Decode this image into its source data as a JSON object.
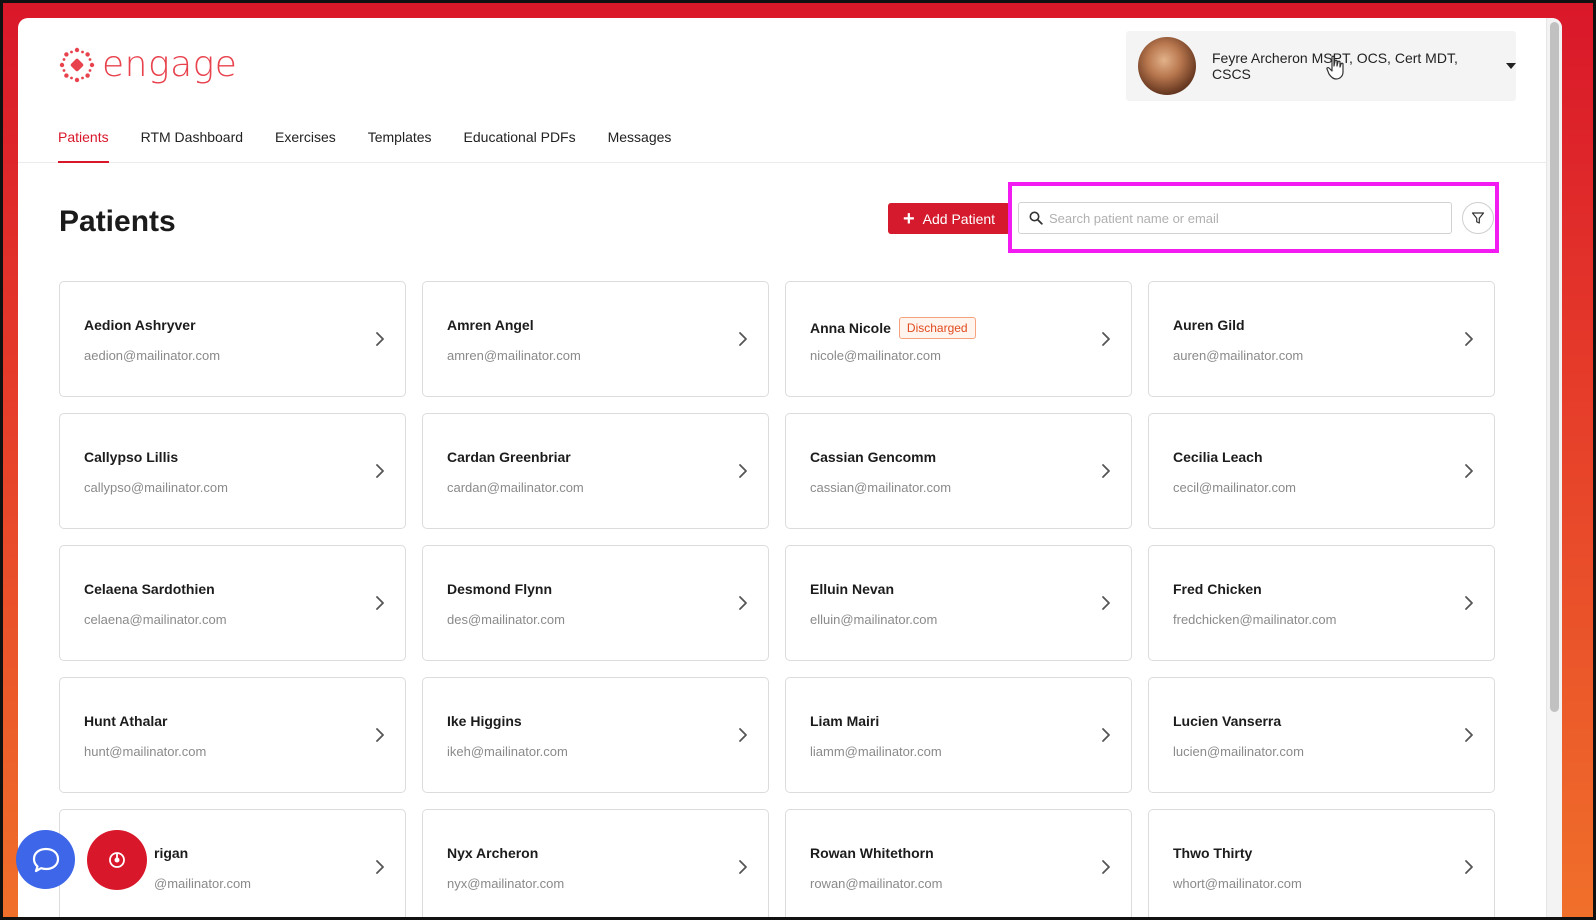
{
  "app": {
    "logo_text": "engage",
    "brand_color": "#d9172a",
    "accent_logo_color": "#e8424d"
  },
  "user": {
    "name": "Feyre Archeron MSPT, OCS, Cert MDT, CSCS",
    "avatar_icon": "user-avatar",
    "dropdown_icon": "caret-down-icon"
  },
  "nav": {
    "items": [
      {
        "label": "Patients",
        "active": true
      },
      {
        "label": "RTM Dashboard",
        "active": false
      },
      {
        "label": "Exercises",
        "active": false
      },
      {
        "label": "Templates",
        "active": false
      },
      {
        "label": "Educational PDFs",
        "active": false
      },
      {
        "label": "Messages",
        "active": false
      }
    ]
  },
  "page": {
    "title": "Patients",
    "add_button_label": "Add Patient",
    "search_placeholder": "Search patient name or email",
    "search_value": "",
    "highlight_color": "#f21cf2"
  },
  "patients": [
    {
      "name": "Aedion Ashryver",
      "email": "aedion@mailinator.com",
      "badge": ""
    },
    {
      "name": "Amren Angel",
      "email": "amren@mailinator.com",
      "badge": ""
    },
    {
      "name": "Anna Nicole",
      "email": "nicole@mailinator.com",
      "badge": "Discharged"
    },
    {
      "name": "Auren Gild",
      "email": "auren@mailinator.com",
      "badge": ""
    },
    {
      "name": "Callypso Lillis",
      "email": "callypso@mailinator.com",
      "badge": ""
    },
    {
      "name": "Cardan Greenbriar",
      "email": "cardan@mailinator.com",
      "badge": ""
    },
    {
      "name": "Cassian Gencomm",
      "email": "cassian@mailinator.com",
      "badge": ""
    },
    {
      "name": "Cecilia Leach",
      "email": "cecil@mailinator.com",
      "badge": ""
    },
    {
      "name": "Celaena Sardothien",
      "email": "celaena@mailinator.com",
      "badge": ""
    },
    {
      "name": "Desmond Flynn",
      "email": "des@mailinator.com",
      "badge": ""
    },
    {
      "name": "Elluin Nevan",
      "email": "elluin@mailinator.com",
      "badge": ""
    },
    {
      "name": "Fred Chicken",
      "email": "fredchicken@mailinator.com",
      "badge": ""
    },
    {
      "name": "Hunt Athalar",
      "email": "hunt@mailinator.com",
      "badge": ""
    },
    {
      "name": "Ike Higgins",
      "email": "ikeh@mailinator.com",
      "badge": ""
    },
    {
      "name": "Liam Mairi",
      "email": "liamm@mailinator.com",
      "badge": ""
    },
    {
      "name": "Lucien Vanserra",
      "email": "lucien@mailinator.com",
      "badge": ""
    },
    {
      "name": "rigan",
      "email": "@mailinator.com",
      "badge": ""
    },
    {
      "name": "Nyx Archeron",
      "email": "nyx@mailinator.com",
      "badge": ""
    },
    {
      "name": "Rowan Whitethorn",
      "email": "rowan@mailinator.com",
      "badge": ""
    },
    {
      "name": "Thwo Thirty",
      "email": "whort@mailinator.com",
      "badge": ""
    }
  ],
  "floating": {
    "chat_icon": "chat-bubble-icon",
    "record_icon": "record-icon"
  }
}
